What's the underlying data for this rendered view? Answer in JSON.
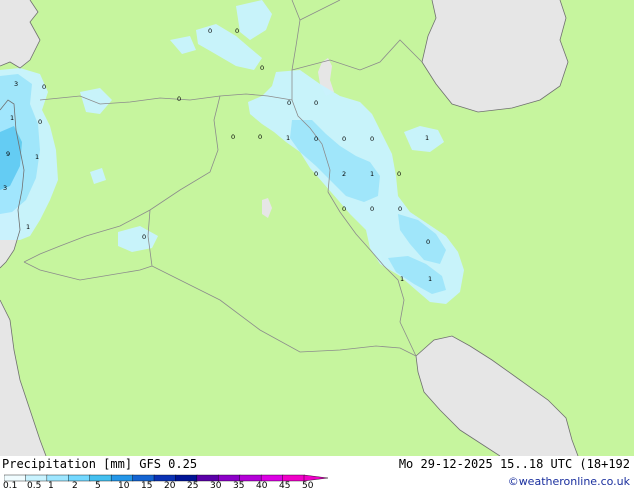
{
  "colors": {
    "land": "#c6f59e",
    "sea": "#e6e6e6",
    "border": "#8c8c8c",
    "coast": "#707070",
    "precip_light": "#c9f3ff",
    "precip_mid": "#9ee6ff",
    "precip_heavy": "#5ecbf4",
    "credit": "#1a2f9e"
  },
  "legend": {
    "title": "Precipitation [mm]  GFS 0.25",
    "ticks": [
      "0.1",
      "0.5",
      "1",
      "2",
      "5",
      "10",
      "15",
      "20",
      "25",
      "30",
      "35",
      "40",
      "45",
      "50"
    ],
    "colors": [
      "#f0fcff",
      "#c9f3ff",
      "#9ee6ff",
      "#73d8ff",
      "#44c0f0",
      "#2496e8",
      "#1464d2",
      "#0a32b4",
      "#001496",
      "#5a00a8",
      "#8c00c8",
      "#b400d8",
      "#dc00e4",
      "#f000c8"
    ]
  },
  "header": {
    "valid_time": "Mo 29-12-2025 15..18 UTC (18+192",
    "credit": "©weatheronline.co.uk"
  },
  "map_labels": [
    {
      "text": "0"
    },
    {
      "text": "0"
    },
    {
      "text": "0"
    },
    {
      "text": "3"
    },
    {
      "text": "0"
    },
    {
      "text": "0"
    },
    {
      "text": "1"
    },
    {
      "text": "0"
    },
    {
      "text": "0"
    },
    {
      "text": "0"
    },
    {
      "text": "9"
    },
    {
      "text": "1"
    },
    {
      "text": "0"
    },
    {
      "text": "0"
    },
    {
      "text": "1"
    },
    {
      "text": "0"
    },
    {
      "text": "0"
    },
    {
      "text": "0"
    },
    {
      "text": "1"
    },
    {
      "text": "3"
    },
    {
      "text": "0"
    },
    {
      "text": "2"
    },
    {
      "text": "1"
    },
    {
      "text": "0"
    },
    {
      "text": "1"
    },
    {
      "text": "0"
    },
    {
      "text": "0"
    },
    {
      "text": "0"
    },
    {
      "text": "0"
    },
    {
      "text": "0"
    },
    {
      "text": "1"
    }
  ]
}
